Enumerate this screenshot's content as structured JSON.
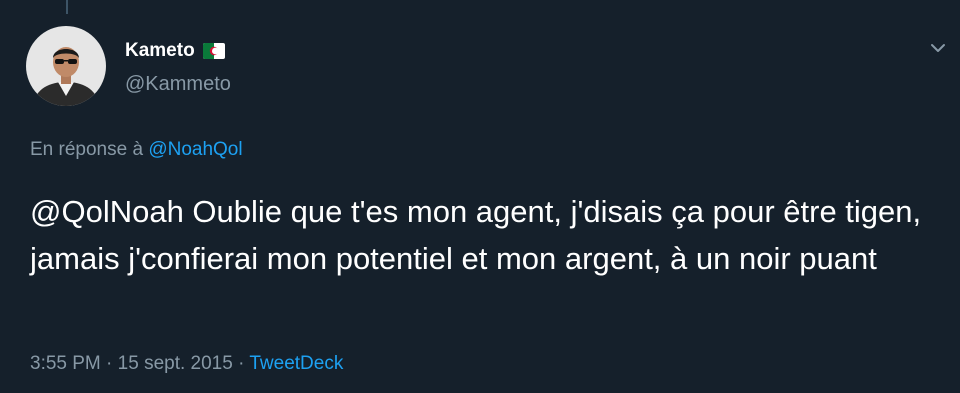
{
  "tweet": {
    "author": {
      "display_name": "Kameto",
      "handle": "@Kammeto",
      "flag": "algeria-flag-icon"
    },
    "menu_icon": "chevron-down-icon",
    "reply_prefix": "En réponse à",
    "reply_to": "@NoahQol",
    "text": "@QolNoah Oublie que t'es mon agent, j'disais ça pour être tigen, jamais j'confierai mon potentiel et mon argent, à un noir puant",
    "time": "3:55 PM",
    "separator": "·",
    "date": "15 sept. 2015",
    "source": "TweetDeck"
  },
  "colors": {
    "background": "#15202b",
    "primary_text": "#ffffff",
    "secondary_text": "#8899a6",
    "accent": "#1da1f2"
  }
}
